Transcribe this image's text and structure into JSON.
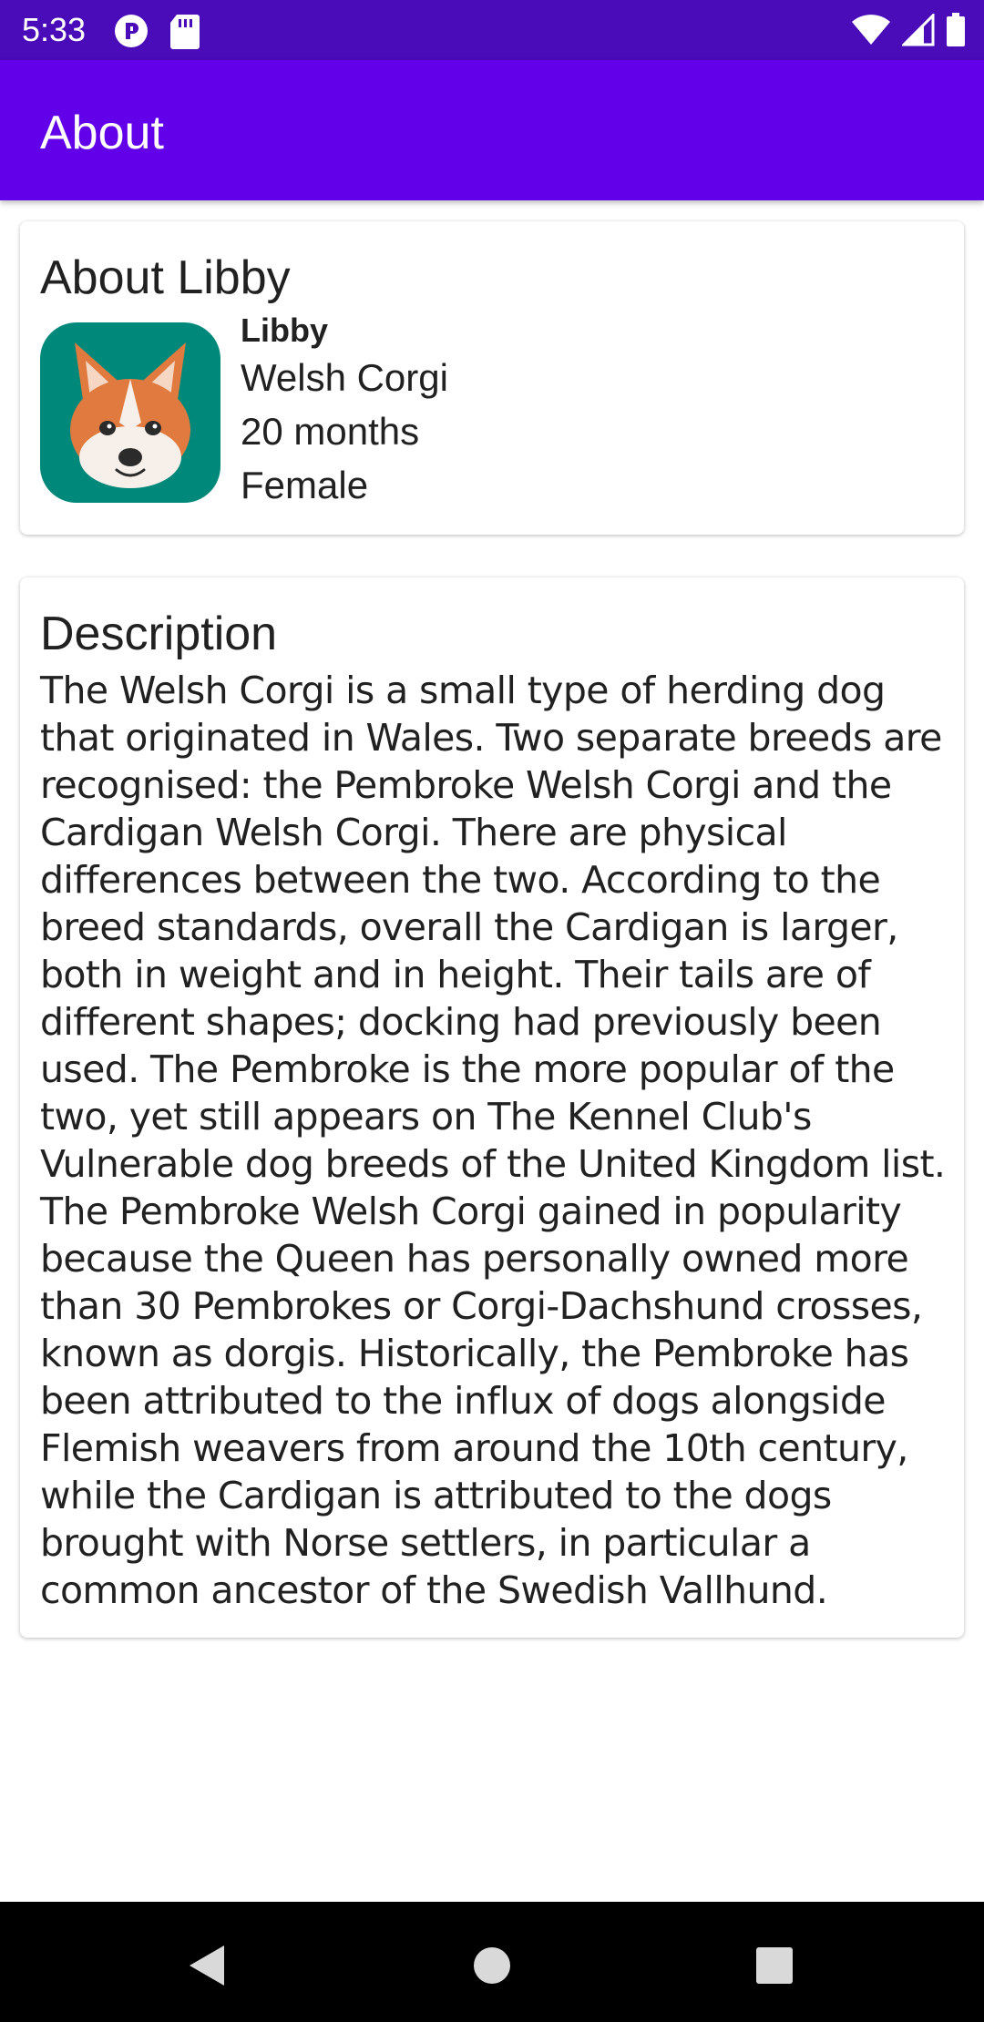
{
  "status_bar": {
    "time": "5:33",
    "icons": [
      "app-notification-icon",
      "sd-card-icon",
      "wifi-icon",
      "cell-signal-icon",
      "battery-icon"
    ]
  },
  "app_bar": {
    "title": "About"
  },
  "about_card": {
    "title": "About Libby",
    "photo_icon": "corgi-face-icon",
    "name": "Libby",
    "breed": "Welsh Corgi",
    "age": "20 months",
    "gender": "Female"
  },
  "description_card": {
    "title": "Description",
    "text": "The Welsh Corgi is a small type of herding dog that originated in Wales. Two separate breeds are recognised: the Pembroke Welsh Corgi and the Cardigan Welsh Corgi. There are physical differences between the two. According to the breed standards, overall the Cardigan is larger, both in weight and in height. Their tails are of different shapes; docking had previously been used. The Pembroke is the more popular of the two, yet still appears on The Kennel Club's Vulnerable dog breeds of the United Kingdom list. The Pembroke Welsh Corgi gained in popularity because the Queen has personally owned more than 30 Pembrokes or Corgi-Dachshund crosses, known as dorgis. Historically, the Pembroke has been attributed to the influx of dogs alongside Flemish weavers from around the 10th century, while the Cardigan is attributed to the dogs brought with Norse settlers, in particular a common ancestor of the Swedish Vallhund."
  },
  "nav_bar": {
    "buttons": [
      "back-icon",
      "home-icon",
      "recents-icon"
    ]
  },
  "colors": {
    "status_bar": "#4a0bb8",
    "app_bar": "#6200ea",
    "photo_background": "#00897b",
    "text": "#212121"
  }
}
